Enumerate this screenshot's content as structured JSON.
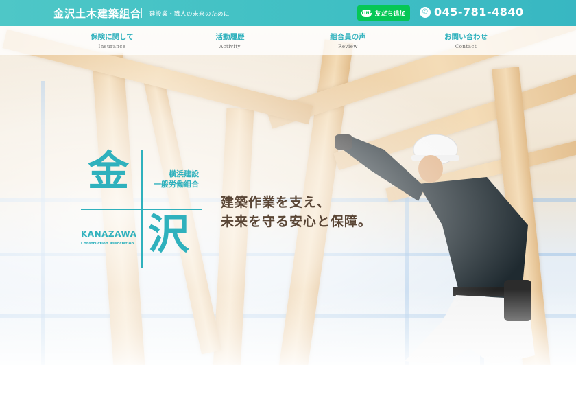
{
  "header": {
    "brand": "金沢土木建築組合",
    "tagline": "建設業・職人の未来のために",
    "line_button": "友だち追加",
    "line_icon": "line-icon",
    "phone": "045-781-4840",
    "phone_icon": "phone-icon"
  },
  "nav": [
    {
      "jp": "保険に関して",
      "en": "Insurance"
    },
    {
      "jp": "活動履歴",
      "en": "Activity"
    },
    {
      "jp": "組合員の声",
      "en": "Review"
    },
    {
      "jp": "お問い合わせ",
      "en": "Contact"
    }
  ],
  "logo": {
    "kanji_top": "金",
    "kanji_bottom": "沢",
    "sub_line1": "横浜建設",
    "sub_line2": "一般労働組合",
    "english": "KANAZAWA",
    "english_sub": "Construction Association"
  },
  "hero": {
    "catch_line1": "建築作業を支え、",
    "catch_line2": "未来を守る安心と保障。"
  },
  "colors": {
    "accent": "#2fb1bd",
    "header": "#3fbfc4",
    "line_green": "#06c755",
    "catch_text": "#5a4636"
  }
}
